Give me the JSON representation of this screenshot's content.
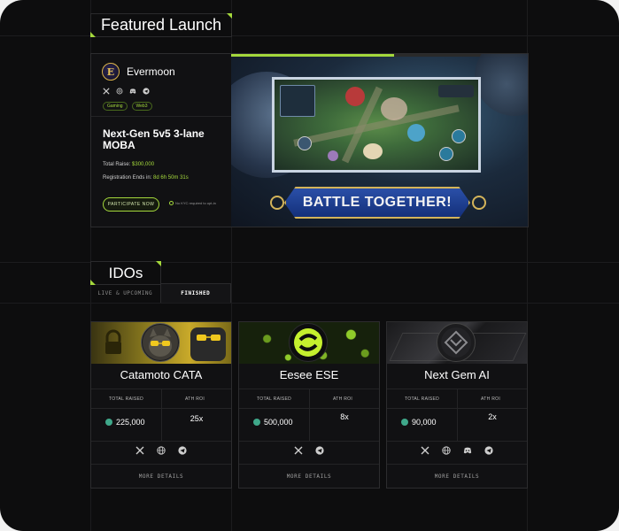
{
  "featured": {
    "section_title": "Featured Launch",
    "name": "Evermoon",
    "logo_letter": "E",
    "tags": [
      "Gaming",
      "Web3"
    ],
    "title": "Next-Gen 5v5 3-lane MOBA",
    "total_raise_label": "Total Raise:",
    "total_raise_value": "$300,000",
    "reg_label": "Registration Ends in:",
    "reg_value": "8d 6h 50m 31s",
    "participate_label": "PARTICIPATE NOW",
    "kyc_note": "No KYC required to opt-in",
    "banner_text": "BATTLE TOGETHER!",
    "socials": [
      "x-icon",
      "website-icon",
      "discord-icon",
      "telegram-icon"
    ]
  },
  "idos": {
    "section_title": "IDOs",
    "tabs": [
      {
        "label": "LIVE & UPCOMING",
        "active": false
      },
      {
        "label": "FINISHED",
        "active": true
      }
    ],
    "total_raised_label": "TOTAL RAISED",
    "ath_roi_label": "ATH ROI",
    "details_label": "MORE DETAILS",
    "projects": [
      {
        "name": "Catamoto  CATA",
        "raised": "225,000",
        "roi": "25x",
        "socials": [
          "x-icon",
          "website-icon",
          "telegram-icon"
        ]
      },
      {
        "name": "Eesee ESE",
        "raised": "500,000",
        "roi": "8x",
        "socials": [
          "x-icon",
          "telegram-icon"
        ]
      },
      {
        "name": "Next Gem AI",
        "raised": "90,000",
        "roi": "2x",
        "socials": [
          "x-icon",
          "website-icon",
          "discord-icon",
          "telegram-icon"
        ]
      }
    ]
  },
  "colors": {
    "accent": "#a4d83c",
    "background": "#0d0d0e",
    "card": "#111113",
    "coin": "#3fa88a"
  }
}
